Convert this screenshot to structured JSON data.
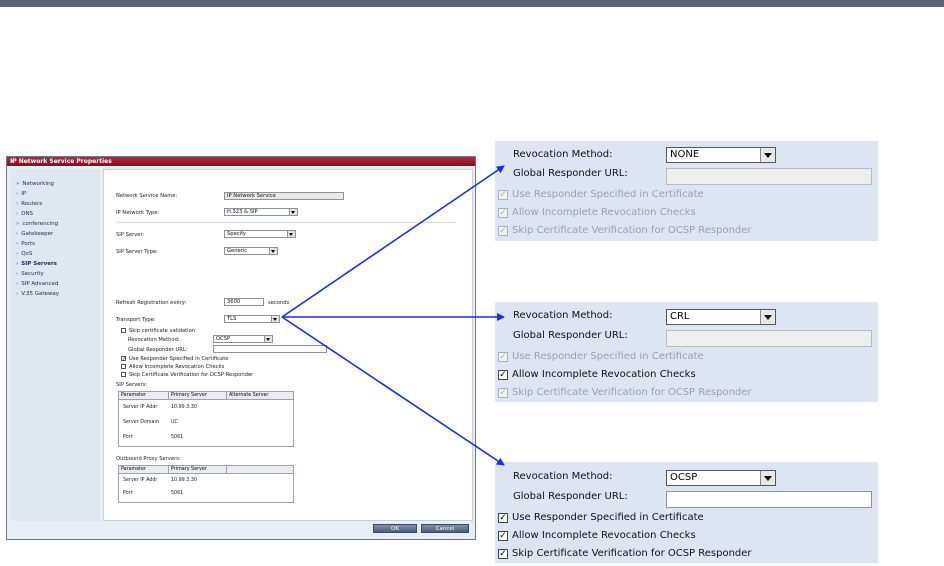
{
  "dialog": {
    "title": "IP Network Service Properties",
    "close": "×",
    "nav": [
      {
        "label": "Networking",
        "bold": false
      },
      {
        "label": "IP",
        "bold": false
      },
      {
        "label": "Routers",
        "bold": false
      },
      {
        "label": "DNS",
        "bold": false
      },
      {
        "label": "conferencing",
        "bold": false
      },
      {
        "label": "Gatekeeper",
        "bold": false
      },
      {
        "label": "Ports",
        "bold": false
      },
      {
        "label": "QoS",
        "bold": false
      },
      {
        "label": "SIP Servers",
        "bold": true
      },
      {
        "label": "Security",
        "bold": false
      },
      {
        "label": "SIP Advanced",
        "bold": false
      },
      {
        "label": "V.35 Gateway",
        "bold": false
      }
    ],
    "network_service_name_label": "Network Service Name:",
    "network_service_name_value": "IP Network Service",
    "ip_network_type_label": "IP Network Type:",
    "ip_network_type_value": "H.323 & SIP",
    "sip_server_label": "SIP Server:",
    "sip_server_value": "Specify",
    "sip_server_type_label": "SIP Server Type:",
    "sip_server_type_value": "Generic",
    "refresh_label": "Refresh Registration every:",
    "refresh_value": "3600",
    "refresh_unit": "seconds",
    "transport_label": "Transport Type:",
    "transport_value": "TLS",
    "skip_validation_label": "Skip certificate validation",
    "revocation_method_label": "Revocation Method:",
    "revocation_method_value": "OCSP",
    "global_responder_label": "Global Responder URL:",
    "use_responder_label": "Use Responder Specified in Certificate",
    "allow_incomplete_label": "Allow Incomplete Revocation Checks",
    "skip_cert_label": "Skip Certificate Verification for OCSP Responder",
    "sip_servers_label": "SIP Servers:",
    "sip_table": {
      "headers": [
        "Parameter",
        "Primary Server",
        "Alternate Server"
      ],
      "rows": [
        [
          "Server IP Addr",
          "10.99.3.30",
          ""
        ],
        [
          "Server Domain",
          "UC",
          ""
        ],
        [
          "Port",
          "5061",
          ""
        ]
      ]
    },
    "outbound_label": "Outbound Proxy Servers:",
    "outbound_table": {
      "headers": [
        "Parameter",
        "Primary Server"
      ],
      "rows": [
        [
          "Server IP Addr",
          "10.99.3.30"
        ],
        [
          "Port",
          "5061"
        ]
      ]
    },
    "ok_label": "OK",
    "cancel_label": "Cancel"
  },
  "zoom_none": {
    "revocation_method_label": "Revocation Method:",
    "revocation_method_value": "NONE",
    "global_responder_label": "Global Responder URL:",
    "use_responder_label": "Use Responder Specified in Certificate",
    "allow_incomplete_label": "Allow Incomplete Revocation Checks",
    "skip_cert_label": "Skip Certificate Verification for OCSP Responder"
  },
  "zoom_crl": {
    "revocation_method_label": "Revocation Method:",
    "revocation_method_value": "CRL",
    "global_responder_label": "Global Responder URL:",
    "use_responder_label": "Use Responder Specified in Certificate",
    "allow_incomplete_label": "Allow Incomplete Revocation Checks",
    "skip_cert_label": "Skip Certificate Verification for OCSP Responder"
  },
  "zoom_ocsp": {
    "revocation_method_label": "Revocation Method:",
    "revocation_method_value": "OCSP",
    "global_responder_label": "Global Responder URL:",
    "use_responder_label": "Use Responder Specified in Certificate",
    "allow_incomplete_label": "Allow Incomplete Revocation Checks",
    "skip_cert_label": "Skip Certificate Verification for OCSP Responder"
  },
  "colors": {
    "arrow": "#1a2fd6",
    "title_bar": "#a11c2f",
    "zoom_bg": "#dde5f3"
  },
  "check_glyph": "✓"
}
